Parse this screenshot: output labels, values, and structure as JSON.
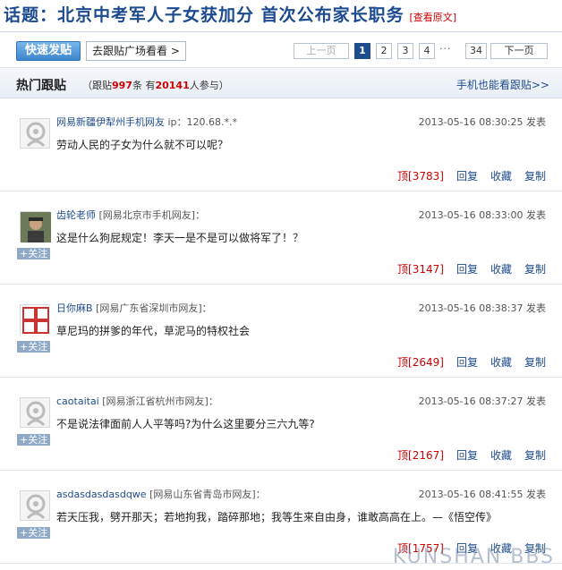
{
  "title": "话题：北京中考军人子女获加分 首次公布家长职务",
  "title_link": "[查看原文]",
  "toolbar": {
    "fast_post": "快速发贴",
    "go_square": "去跟贴广场看看"
  },
  "pager": {
    "prev": "上一页",
    "pages": [
      "1",
      "2",
      "3",
      "4"
    ],
    "dots": "···",
    "last": "34",
    "next": "下一页"
  },
  "hot": {
    "title": "热门跟贴",
    "stats_prefix": "（跟贴",
    "post_count": "997",
    "stats_mid": "条 有",
    "user_count": "20141",
    "stats_suffix": "人参与）",
    "mobile": "手机也能看跟贴>>"
  },
  "posts": [
    {
      "user": "网易新疆伊犁州手机网友",
      "loc": " ip：120.68.*.*",
      "date": "2013-05-16 08:30:25 发表",
      "content": "劳动人民的子女为什么就不可以呢？",
      "up": "顶[3783]",
      "follow": "",
      "avatar": "default"
    },
    {
      "user": "齿轮老师",
      "loc": " [网易北京市手机网友]：",
      "date": "2013-05-16 08:33:00 发表",
      "content": "这是什么狗屁规定！李天一是不是可以做将军了！？",
      "up": "顶[3147]",
      "follow": "+关注",
      "avatar": "photo"
    },
    {
      "user": "日你麻B",
      "loc": " [网易广东省深圳市网友]：",
      "date": "2013-05-16 08:38:37 发表",
      "content": "草尼玛的拼爹的年代，草泥马的特权社会",
      "up": "顶[2649]",
      "follow": "+关注",
      "avatar": "seal"
    },
    {
      "user": "caotaitai",
      "loc": " [网易浙江省杭州市网友]：",
      "date": "2013-05-16 08:37:27 发表",
      "content": "不是说法律面前人人平等吗?为什么这里要分三六九等?",
      "up": "顶[2167]",
      "follow": "+关注",
      "avatar": "default"
    },
    {
      "user": "asdasdasdasdqwe",
      "loc": " [网易山东省青岛市网友]：",
      "date": "2013-05-16 08:41:55 发表",
      "content": "若天压我，劈开那天；若地拘我，踏碎那地；我等生来自由身，谁敢高高在上。—《悟空传》",
      "up": "顶[1757]",
      "follow": "+关注",
      "avatar": "default"
    }
  ],
  "actions": {
    "reply": "回复",
    "fav": "收藏",
    "copy": "复制"
  },
  "watermark": "KUNSHAN BBS",
  "colors": {
    "link_blue": "#1e4c8c",
    "count_red": "#cc0000",
    "title_blue": "#1b4a8f"
  }
}
